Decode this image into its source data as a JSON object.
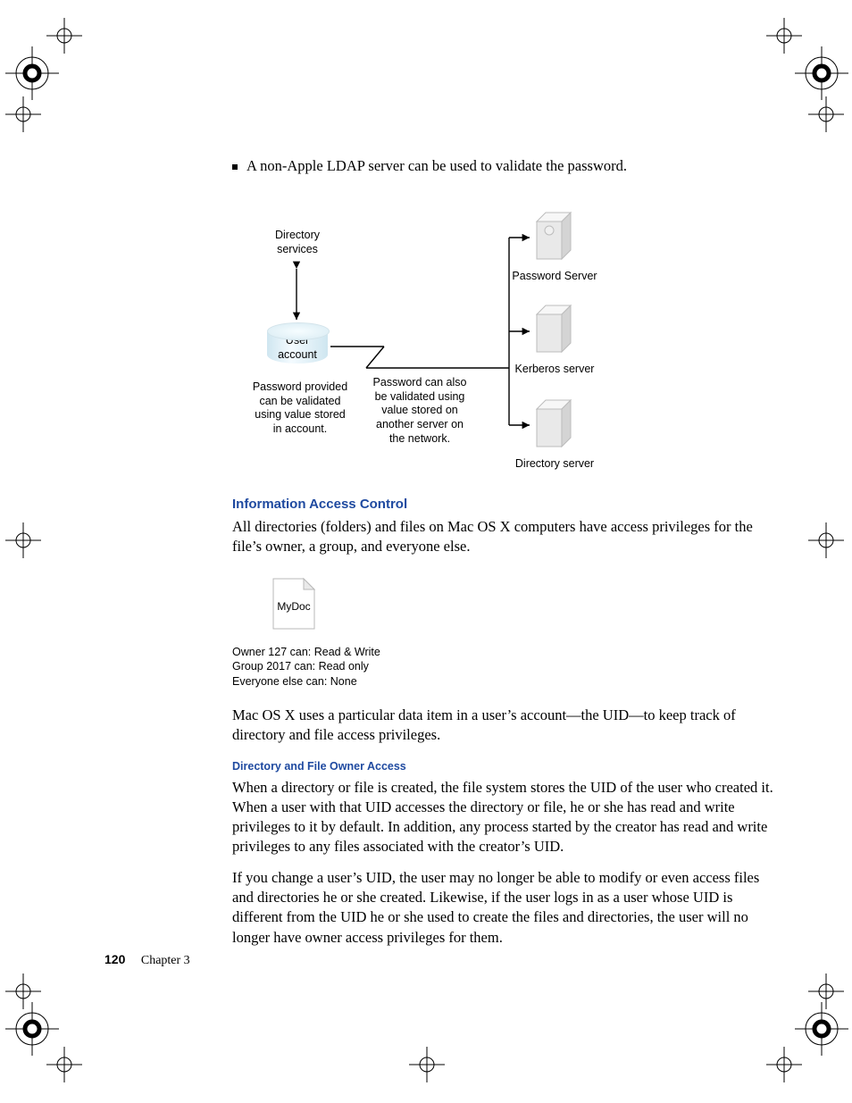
{
  "bullet": "A non-Apple LDAP server can be used to validate the password.",
  "diagram": {
    "dir_services": "Directory\nservices",
    "user_account": "User\naccount",
    "cap_pw_account": "Password provided\ncan be validated\nusing value stored\nin account.",
    "cap_pw_network": "Password can also\nbe validated using\nvalue stored on\nanother server on\nthe network.",
    "password_server": "Password Server",
    "kerberos_server": "Kerberos server",
    "directory_server": "Directory server"
  },
  "h_info_access": "Information Access Control",
  "p_info_access": "All directories (folders) and files on Mac OS X computers have access privileges for the file’s owner, a group, and everyone else.",
  "doc_name": "MyDoc",
  "perms": {
    "l1": "Owner 127 can: Read & Write",
    "l2": "Group 2017 can: Read only",
    "l3": "Everyone else can: None"
  },
  "p_uid": "Mac OS X uses a particular data item in a user’s account—the UID—to keep track of directory and file access privileges.",
  "h_owner_access": "Directory and File Owner Access",
  "p_owner1": "When a directory or file is created, the file system stores the UID of the user who created it. When a user with that UID accesses the directory or file, he or she has read and write privileges to it by default. In addition, any process started by the creator has read and write privileges to any files associated with the creator’s UID.",
  "p_owner2": "If you change a user’s UID, the user may no longer be able to modify or even access files and directories he or she created. Likewise, if the user logs in as a user whose UID is different from the UID he or she used to create the files and directories, the user will no longer have owner access privileges for them.",
  "footer": {
    "page": "120",
    "chapter": "Chapter 3"
  }
}
